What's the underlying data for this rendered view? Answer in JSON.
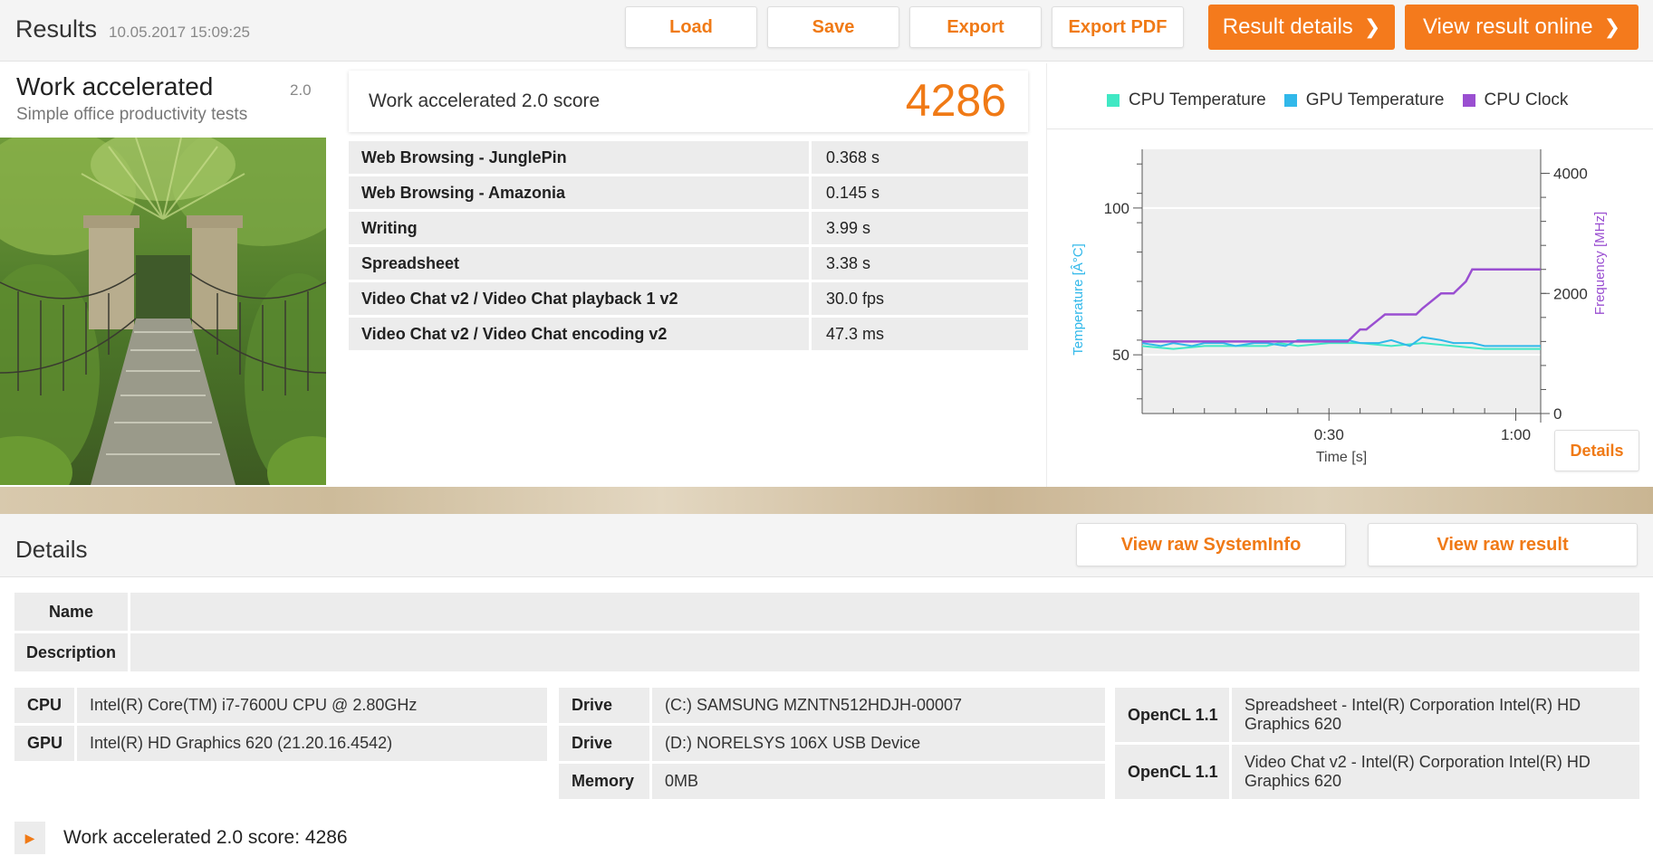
{
  "header": {
    "title": "Results",
    "date": "10.05.2017 15:09:25",
    "buttons": {
      "load": "Load",
      "save": "Save",
      "export": "Export",
      "export_pdf": "Export PDF",
      "result_details": "Result details",
      "view_online": "View result online"
    }
  },
  "test": {
    "name": "Work accelerated",
    "version": "2.0",
    "subtitle": "Simple office productivity tests"
  },
  "score": {
    "label": "Work accelerated 2.0 score",
    "value": "4286"
  },
  "results": [
    {
      "name": "Web Browsing - JunglePin",
      "value": "0.368 s"
    },
    {
      "name": "Web Browsing - Amazonia",
      "value": "0.145 s"
    },
    {
      "name": "Writing",
      "value": "3.99 s"
    },
    {
      "name": "Spreadsheet",
      "value": "3.38 s"
    },
    {
      "name": "Video Chat v2 / Video Chat playback 1 v2",
      "value": "30.0 fps"
    },
    {
      "name": "Video Chat v2 / Video Chat encoding v2",
      "value": "47.3 ms"
    }
  ],
  "chart": {
    "details_label": "Details",
    "colors": {
      "cpu_temp": "#40e8c4",
      "gpu_temp": "#31b8ea",
      "cpu_clock": "#9a4fd1"
    }
  },
  "chart_data": {
    "type": "line",
    "xlabel": "Time [s]",
    "ylabel_left": "Temperature [Â°C]",
    "ylabel_right": "Frequency [MHz]",
    "x_ticks": [
      "0:30",
      "1:00"
    ],
    "y_left_ticks": [
      "50",
      "100"
    ],
    "y_right_ticks": [
      "0",
      "2000",
      "4000"
    ],
    "xlim": [
      0,
      64
    ],
    "ylim_left": [
      30,
      120
    ],
    "ylim_right": [
      0,
      4400
    ],
    "series": [
      {
        "name": "CPU Temperature",
        "axis": "left",
        "x": [
          0,
          5,
          10,
          15,
          20,
          22,
          25,
          30,
          35,
          40,
          45,
          50,
          55,
          60,
          64
        ],
        "y": [
          53,
          52,
          53,
          53,
          53,
          54,
          53,
          54,
          54,
          53,
          54,
          53,
          52,
          52,
          52
        ]
      },
      {
        "name": "GPU Temperature",
        "axis": "left",
        "x": [
          0,
          3,
          5,
          8,
          10,
          13,
          15,
          18,
          20,
          23,
          25,
          28,
          30,
          33,
          35,
          38,
          40,
          43,
          45,
          48,
          50,
          53,
          55,
          58,
          60,
          64
        ],
        "y": [
          54,
          53,
          54,
          53,
          54,
          54,
          53,
          54,
          54,
          53,
          55,
          55,
          55,
          55,
          54,
          54,
          55,
          53,
          56,
          55,
          54,
          54,
          53,
          53,
          53,
          53
        ]
      },
      {
        "name": "CPU Clock",
        "axis": "right",
        "x": [
          0,
          33,
          35,
          36,
          39,
          40,
          44,
          45,
          48,
          50,
          52,
          53,
          56,
          64
        ],
        "y": [
          1200,
          1200,
          1400,
          1400,
          1650,
          1650,
          1650,
          1750,
          2000,
          2000,
          2200,
          2400,
          2400,
          2400
        ]
      }
    ]
  },
  "details": {
    "title": "Details",
    "buttons": {
      "raw_sysinfo": "View raw SystemInfo",
      "raw_result": "View raw result"
    },
    "name_key": "Name",
    "description_key": "Description"
  },
  "system": {
    "col1": [
      {
        "key": "CPU",
        "value": "Intel(R) Core(TM) i7-7600U CPU @ 2.80GHz"
      },
      {
        "key": "GPU",
        "value": "Intel(R) HD Graphics 620 (21.20.16.4542)"
      }
    ],
    "col2": [
      {
        "key": "Drive",
        "value": "(C:) SAMSUNG MZNTN512HDJH-00007"
      },
      {
        "key": "Drive",
        "value": "(D:) NORELSYS 106X USB Device"
      },
      {
        "key": "Memory",
        "value": "0MB"
      }
    ],
    "col3": [
      {
        "key": "OpenCL 1.1",
        "value": "Spreadsheet - Intel(R) Corporation Intel(R) HD Graphics 620"
      },
      {
        "key": "OpenCL 1.1",
        "value": "Video Chat v2 - Intel(R) Corporation Intel(R) HD Graphics 620"
      }
    ]
  },
  "footer": {
    "score_line": "Work accelerated 2.0 score: 4286"
  }
}
